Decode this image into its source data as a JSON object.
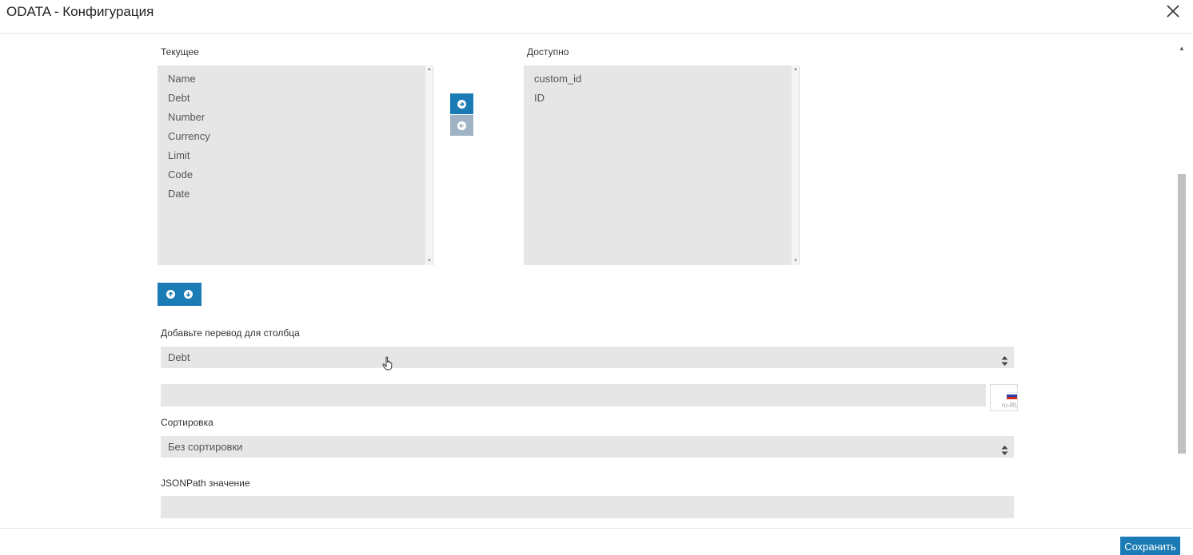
{
  "window": {
    "title": "ODATA - Конфигурация"
  },
  "current": {
    "label": "Текущее",
    "items": [
      "Name",
      "Debt",
      "Number",
      "Currency",
      "Limit",
      "Code",
      "Date"
    ]
  },
  "available": {
    "label": "Доступно",
    "items": [
      "custom_id",
      "ID"
    ]
  },
  "translation": {
    "label": "Добавьте перевод для столбца",
    "selected": "Debt",
    "input_value": "",
    "locale": "ru-RU"
  },
  "sorting": {
    "label": "Сортировка",
    "selected": "Без сортировки"
  },
  "jsonpath": {
    "label": "JSONPath значение",
    "value": ""
  },
  "footer": {
    "save_label": "Сохранить"
  },
  "colors": {
    "accent": "#1b7bb5",
    "accent_disabled": "#9fb3c5",
    "field_bg": "#e6e6e6"
  },
  "icons": {
    "close": "close-icon",
    "move_right": "arrow-right-circle-icon",
    "move_left": "arrow-left-circle-icon",
    "move_up": "arrow-up-circle-icon",
    "move_down": "arrow-down-circle-icon",
    "select": "sort-arrows-icon",
    "flag": "russian-flag-icon"
  }
}
